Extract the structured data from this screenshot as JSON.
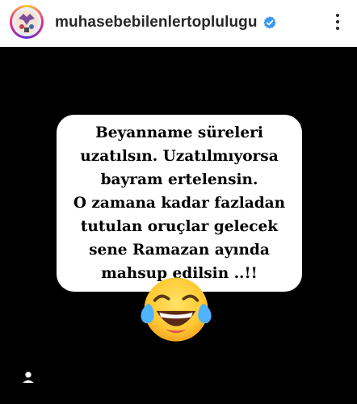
{
  "header": {
    "username": "muhasebebilenlertoplulugu",
    "avatar_icon": "profile-avatar",
    "verified_icon": "verified-badge-icon",
    "more_icon": "more-vertical-icon"
  },
  "post": {
    "background": "#000000",
    "text_lines": [
      "Beyanname süreleri",
      "uzatılsın. Uzatılmıyorsa",
      "bayram ertelensin.",
      "O zamana kadar fazladan",
      "tutulan oruçlar gelecek",
      "sene Ramazan ayında",
      "mahsup edilsin ..!!"
    ],
    "emoji": "face-with-tears-of-joy-emoji",
    "tag_icon": "user-tag-icon"
  },
  "colors": {
    "verified_blue": "#3897f0",
    "text_dark": "#262626",
    "emoji_yellow": "#ffcc33"
  }
}
